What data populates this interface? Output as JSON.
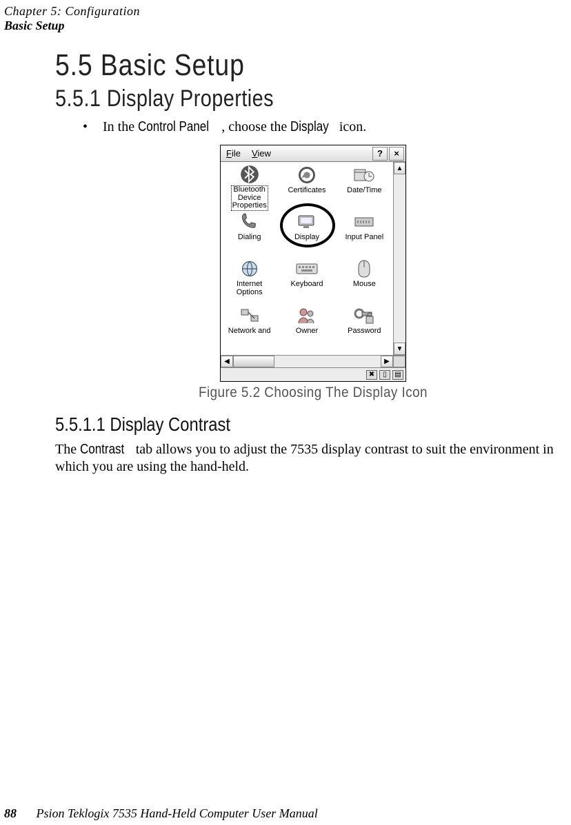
{
  "header": {
    "chapter": "Chapter 5: Configuration",
    "section_title": "Basic Setup"
  },
  "headings": {
    "h55": "5.5   Basic Setup",
    "h551": "5.5.1   Display Properties",
    "h5511": "5.5.1.1     Display Contrast"
  },
  "bullet": {
    "pre": "In the ",
    "cp": "Control Panel",
    "mid": ", choose the ",
    "disp": "Display",
    "post": " icon."
  },
  "figure_caption": "Figure 5.2 Choosing The Display Icon",
  "para": {
    "pre": "The ",
    "contrast": "Contrast",
    "rest": " tab allows you to adjust the 7535 display contrast to suit the environment in which you are using the hand-held."
  },
  "footer": {
    "page": "88",
    "book": "Psion Teklogix 7535 Hand-Held Computer User Manual"
  },
  "cp_window": {
    "menu_file": "File",
    "menu_view": "View",
    "help": "?",
    "close": "×",
    "icons": {
      "r1c1": "Bluetooth\nDevice\nProperties",
      "r1c2": "Certificates",
      "r1c3": "Date/Time",
      "r2c1": "Dialing",
      "r2c2": "Display",
      "r2c3": "Input Panel",
      "r3c1": "Internet\nOptions",
      "r3c2": "Keyboard",
      "r3c3": "Mouse",
      "r4c1": "Network and",
      "r4c2": "Owner",
      "r4c3": "Password"
    },
    "scroll": {
      "up": "▲",
      "down": "▼",
      "left": "◀",
      "right": "▶"
    },
    "tray": {
      "a": "✖",
      "b": "▯",
      "c": "▤"
    }
  }
}
